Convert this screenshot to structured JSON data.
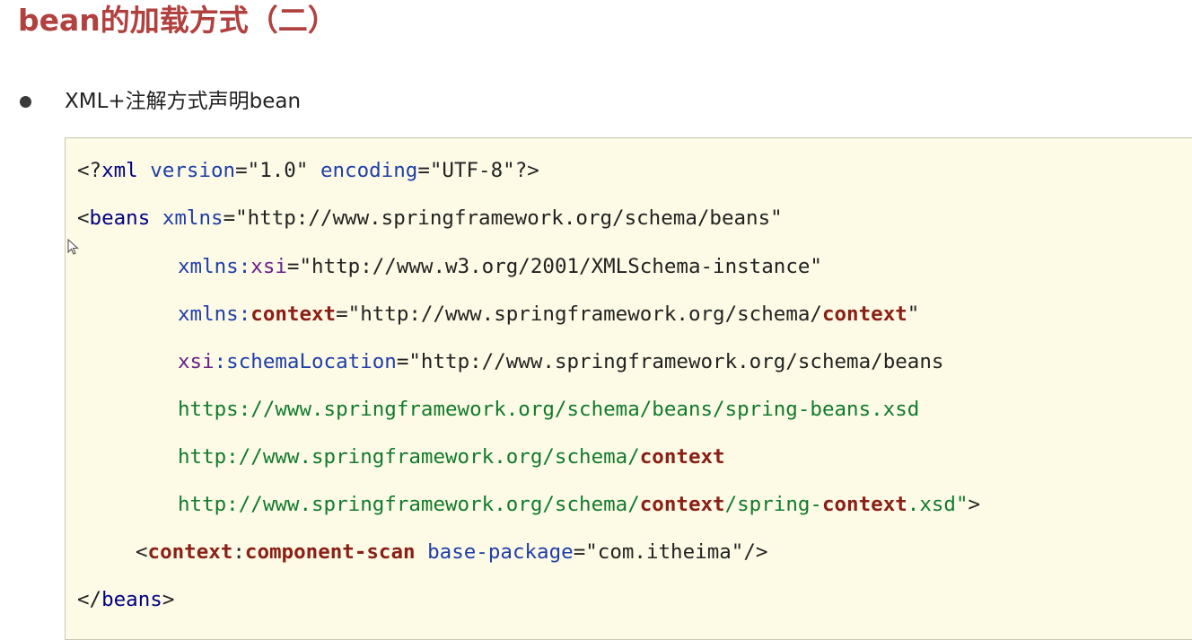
{
  "title": "bean的加载方式（二）",
  "bullet": {
    "text": "XML+注解方式声明bean"
  },
  "code": {
    "l1": {
      "a": "<?",
      "b": "xml",
      "c": " ",
      "d": "version",
      "e": "=",
      "f": "\"1.0\"",
      "g": " ",
      "h": "encoding",
      "i": "=",
      "j": "\"UTF-8\"",
      "k": "?>"
    },
    "l2": {
      "a": "<",
      "b": "beans",
      "c": " ",
      "d": "xmlns",
      "e": "=",
      "f": "\"http://www.springframework.org/schema/beans\""
    },
    "l3": {
      "a": "xmlns:",
      "b": "xsi",
      "c": "=",
      "d": "\"http://www.w3.org/2001/XMLSchema-instance\""
    },
    "l4": {
      "a": "xmlns:",
      "b": "context",
      "c": "=",
      "d": "\"http://www.springframework.org/schema/",
      "e": "context",
      "f": "\""
    },
    "l5": {
      "a": "xsi",
      "b": ":schemaLocation",
      "c": "=",
      "d": "\"http://www.springframework.org/schema/beans"
    },
    "l6": {
      "a": "https://www.springframework.org/schema/beans/spring-beans.xsd"
    },
    "l7": {
      "a": "http://www.springframework.org/schema/",
      "b": "context"
    },
    "l8": {
      "a": "http://www.springframework.org/schema/",
      "b": "context",
      "c": "/spring-",
      "d": "context",
      "e": ".xsd\"",
      "f": ">"
    },
    "l9": {
      "a": "<",
      "b": "context",
      "c": ":",
      "d": "component-scan",
      "e": " ",
      "f": "base-package",
      "g": "=",
      "h": "\"com.itheima\"",
      "i": "/>"
    },
    "l10": {
      "a": "</",
      "b": "beans",
      "c": ">"
    }
  }
}
